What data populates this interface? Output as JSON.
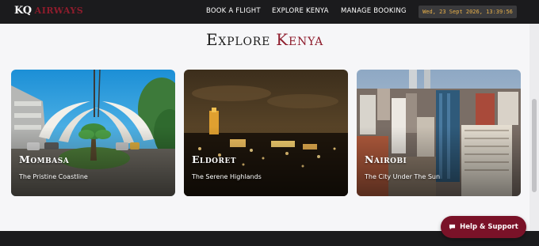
{
  "header": {
    "logo_primary": "KQ",
    "logo_secondary": "AIRWAYS",
    "nav": [
      {
        "label": "BOOK A FLIGHT"
      },
      {
        "label": "EXPLORE KENYA"
      },
      {
        "label": "MANAGE BOOKING"
      }
    ],
    "clock": "Wed, 23 Sept 2026, 13:39:56"
  },
  "main": {
    "title_part1": "Explore",
    "title_part2": "Kenya",
    "destinations": [
      {
        "name": "Mombasa",
        "tagline": "The Pristine Coastline",
        "image_icon": "tusks-monument-image"
      },
      {
        "name": "Eldoret",
        "tagline": "The Serene Highlands",
        "image_icon": "night-city-image"
      },
      {
        "name": "Nairobi",
        "tagline": "The City Under The Sun",
        "image_icon": "skyline-image"
      }
    ]
  },
  "support": {
    "label": "Help & Support",
    "icon": "chat-bubble-icon"
  },
  "colors": {
    "brand": "#8e1c2c",
    "header_bg": "#1b1b1d",
    "support_bg": "#7a1228",
    "clock_text": "#e8b04a"
  }
}
